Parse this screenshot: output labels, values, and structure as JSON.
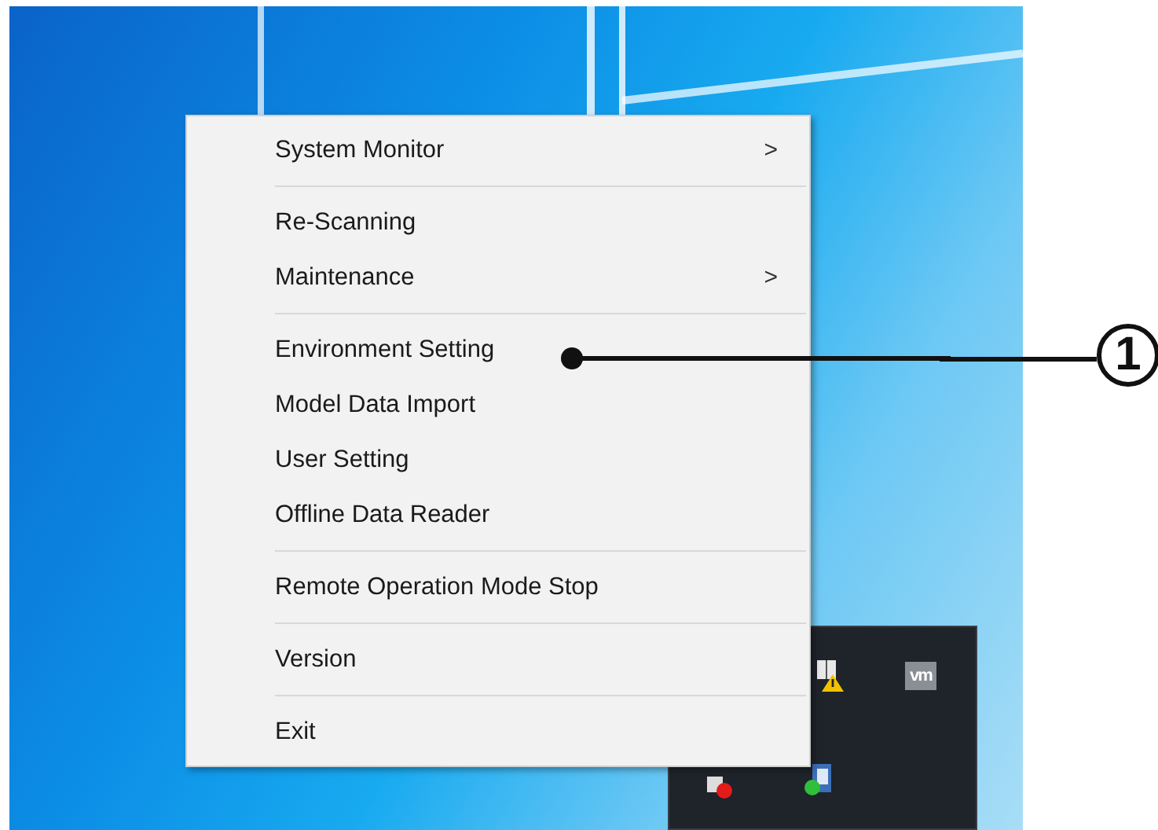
{
  "menu": {
    "items": [
      {
        "kind": "item",
        "label": "System Monitor",
        "submenu": true
      },
      {
        "kind": "separator"
      },
      {
        "kind": "item",
        "label": "Re-Scanning",
        "submenu": false
      },
      {
        "kind": "item",
        "label": "Maintenance",
        "submenu": true
      },
      {
        "kind": "separator"
      },
      {
        "kind": "item",
        "label": "Environment Setting",
        "submenu": false
      },
      {
        "kind": "item",
        "label": "Model Data Import",
        "submenu": false
      },
      {
        "kind": "item",
        "label": "User Setting",
        "submenu": false
      },
      {
        "kind": "item",
        "label": "Offline Data Reader",
        "submenu": false
      },
      {
        "kind": "separator"
      },
      {
        "kind": "item",
        "label": "Remote Operation Mode Stop",
        "submenu": false
      },
      {
        "kind": "separator"
      },
      {
        "kind": "item",
        "label": "Version",
        "submenu": false
      },
      {
        "kind": "separator"
      },
      {
        "kind": "item",
        "label": "Exit",
        "submenu": false
      }
    ],
    "submenu_glyph": ">"
  },
  "tray": {
    "icons": [
      {
        "kind": "warning-app"
      },
      {
        "kind": "vm",
        "label": "vm"
      },
      {
        "kind": "alert-app"
      },
      {
        "kind": "monitor-app"
      }
    ]
  },
  "callout": {
    "label": "1"
  }
}
